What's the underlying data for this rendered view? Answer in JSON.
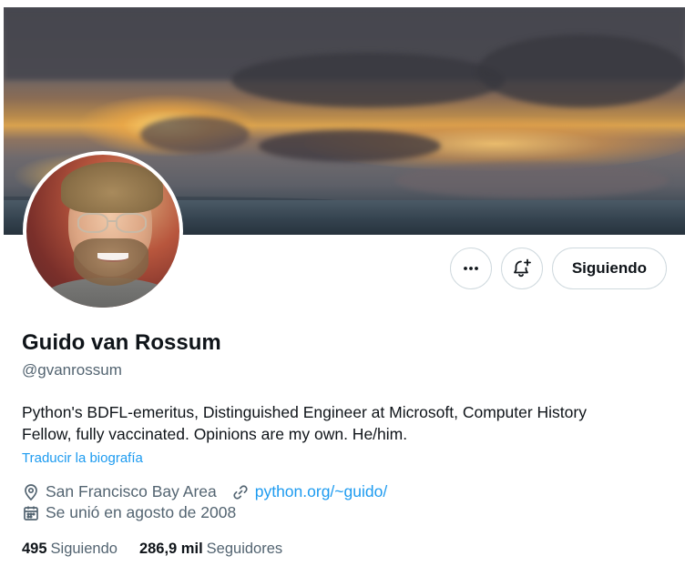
{
  "banner": {
    "description_icon": "sunset-banner-image"
  },
  "avatar": {
    "icon": "profile-photo"
  },
  "actions": {
    "more_icon": "more-dots-icon",
    "notify_icon": "bell-plus-icon",
    "follow_label": "Siguiendo"
  },
  "profile": {
    "name": "Guido van Rossum",
    "handle": "@gvanrossum",
    "bio_line1": "Python's BDFL-emeritus, Distinguished Engineer at Microsoft, Computer History",
    "bio_line2": "Fellow, fully vaccinated. Opinions are my own. He/him.",
    "translate": "Traducir la biografía",
    "location": "San Francisco Bay Area",
    "website": "python.org/~guido/",
    "joined": "Se unió en agosto de 2008"
  },
  "stats": {
    "following_count": "495",
    "following_label": "Siguiendo",
    "followers_count": "286,9 mil",
    "followers_label": "Seguidores"
  },
  "colors": {
    "accent": "#1d9bf0",
    "secondary_text": "#536471",
    "primary_text": "#0f1419",
    "border": "#cfd9de"
  }
}
